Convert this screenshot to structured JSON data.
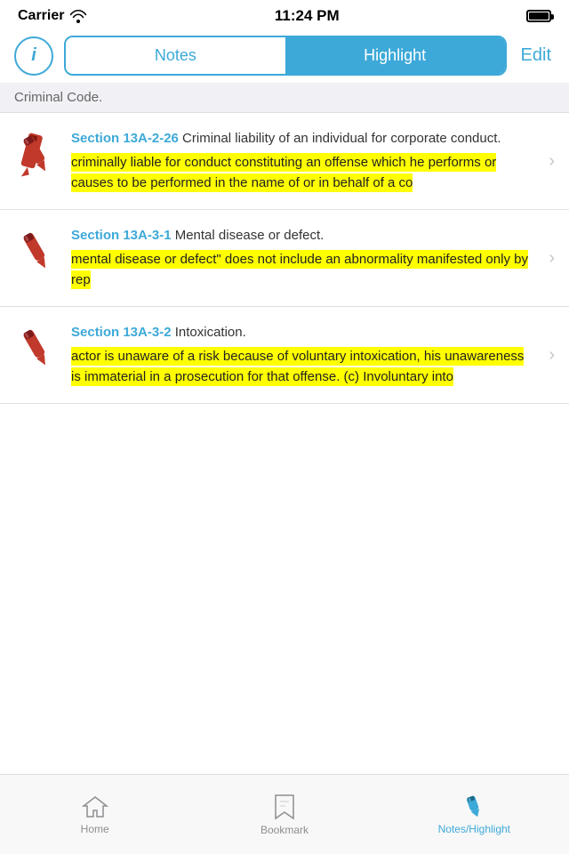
{
  "statusBar": {
    "carrier": "Carrier",
    "time": "11:24 PM"
  },
  "header": {
    "infoLabel": "i",
    "notesLabel": "Notes",
    "highlightLabel": "Highlight",
    "editLabel": "Edit",
    "activeTab": "highlight"
  },
  "sectionHeader": {
    "text": "Criminal Code."
  },
  "items": [
    {
      "id": "item-1",
      "sectionNumber": "Section 13A-2-26",
      "sectionDesc": " Criminal liability of an individual for corporate conduct.",
      "highlightedText": "criminally liable for conduct constituting an offense which he performs or causes to be performed in the name of or in behalf of a co"
    },
    {
      "id": "item-2",
      "sectionNumber": "Section 13A-3-1",
      "sectionDesc": " Mental disease or defect.",
      "highlightedText": "mental disease or defect\" does not include an abnormality manifested only by rep"
    },
    {
      "id": "item-3",
      "sectionNumber": "Section 13A-3-2",
      "sectionDesc": " Intoxication.",
      "highlightedText": "actor is unaware of a risk because of voluntary intoxication, his unawareness is immaterial in a prosecution for that offense.\n(c) Involuntary into"
    }
  ],
  "tabBar": {
    "home": "Home",
    "bookmark": "Bookmark",
    "notesHighlight": "Notes/Highlight"
  }
}
